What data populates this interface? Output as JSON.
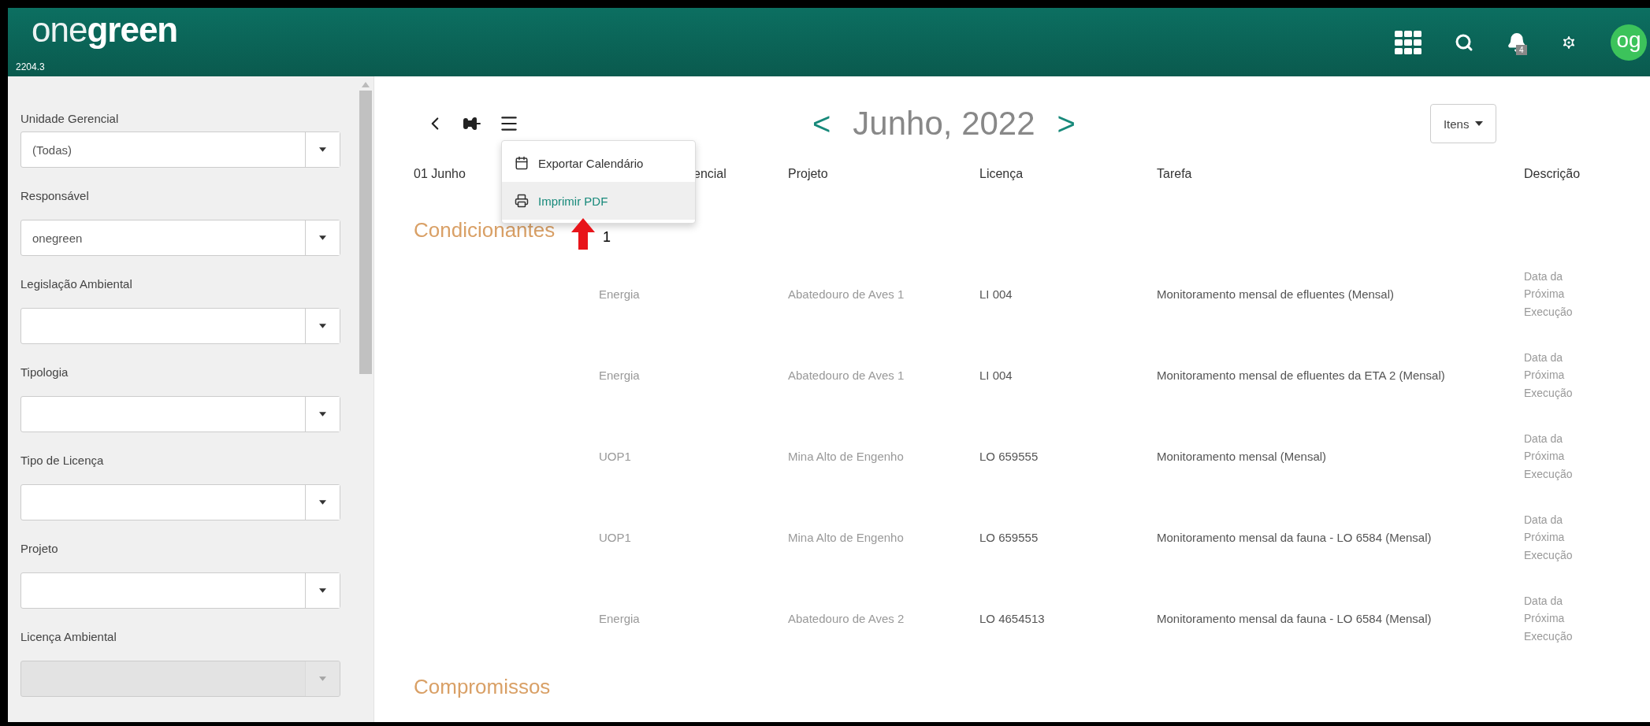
{
  "header": {
    "logo": {
      "light": "one",
      "bold": "green"
    },
    "version": "2204.3",
    "notification_count": "4",
    "avatar": "og"
  },
  "sidebar": {
    "filters": [
      {
        "label": "Unidade Gerencial",
        "value": "(Todas)",
        "disabled": false
      },
      {
        "label": "Responsável",
        "value": "onegreen",
        "disabled": false
      },
      {
        "label": "Legislação Ambiental",
        "disabled": false
      },
      {
        "label": "Tipologia",
        "disabled": false
      },
      {
        "label": "Tipo de Licença",
        "disabled": false
      },
      {
        "label": "Projeto",
        "disabled": false
      },
      {
        "label": "Licença Ambiental",
        "disabled": true
      }
    ]
  },
  "toolbar": {
    "prev": "<",
    "month_title": "Junho, 2022",
    "next": ">",
    "items_button": "Itens"
  },
  "menu": {
    "items": [
      {
        "label": "Exportar Calendário",
        "selected": false
      },
      {
        "label": "Imprimir PDF",
        "selected": true
      }
    ]
  },
  "annotation": {
    "label": "1"
  },
  "table": {
    "columns": [
      "01 Junho",
      "encial",
      "Projeto",
      "Licença",
      "Tarefa",
      "Descrição"
    ],
    "sections": [
      {
        "title": "Condicionantes",
        "rows": [
          {
            "unit": "Energia",
            "project": "Abatedouro de Aves 1",
            "license": "LI 004",
            "task": "Monitoramento mensal de efluentes (Mensal)",
            "description": "Data da Próxima Execução"
          },
          {
            "unit": "Energia",
            "project": "Abatedouro de Aves 1",
            "license": "LI 004",
            "task": "Monitoramento mensal de efluentes da ETA 2 (Mensal)",
            "description": "Data da Próxima Execução"
          },
          {
            "unit": "UOP1",
            "project": "Mina Alto de Engenho",
            "license": "LO 659555",
            "task": "Monitoramento mensal (Mensal)",
            "description": "Data da Próxima Execução"
          },
          {
            "unit": "UOP1",
            "project": "Mina Alto de Engenho",
            "license": "LO 659555",
            "task": "Monitoramento mensal da fauna - LO 6584 (Mensal)",
            "description": "Data da Próxima Execução"
          },
          {
            "unit": "Energia",
            "project": "Abatedouro de Aves 2",
            "license": "LO 4654513",
            "task": "Monitoramento mensal da fauna - LO 6584 (Mensal)",
            "description": "Data da Próxima Execução"
          }
        ]
      },
      {
        "title": "Compromissos"
      }
    ]
  }
}
